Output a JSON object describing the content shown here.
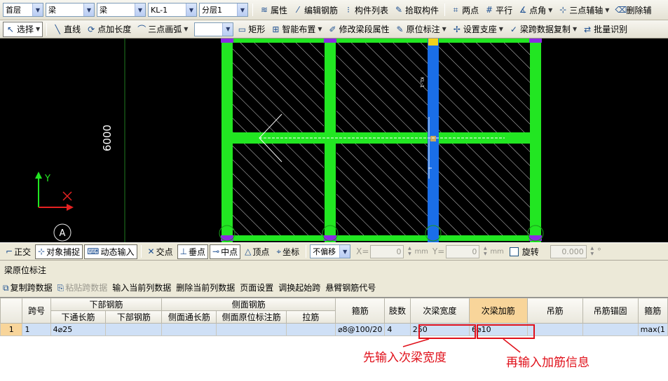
{
  "toolbar1": {
    "combos": [
      {
        "value": "首层",
        "w": 58
      },
      {
        "value": "梁",
        "w": 70
      },
      {
        "value": "梁",
        "w": 70
      },
      {
        "value": "KL-1",
        "w": 70
      },
      {
        "value": "分层1",
        "w": 70
      }
    ],
    "buttons": [
      {
        "icon": "≋",
        "label": "属性",
        "name": "properties-button"
      },
      {
        "icon": "⁄",
        "label": "编辑钢筋",
        "name": "edit-rebar-button"
      },
      {
        "icon": "⁝",
        "label": "构件列表",
        "name": "component-list-button"
      },
      {
        "icon": "✎",
        "label": "拾取构件",
        "name": "pick-component-button"
      },
      {
        "icon": "⌗",
        "label": "两点",
        "name": "two-point-button"
      },
      {
        "icon": "#",
        "label": "平行",
        "name": "parallel-button"
      },
      {
        "icon": "∡",
        "label": "点角",
        "name": "point-angle-button",
        "dd": true
      },
      {
        "icon": "⊹",
        "label": "三点辅轴",
        "name": "three-point-axis-button",
        "dd": true
      },
      {
        "icon": "⌫",
        "label": "删除辅",
        "name": "delete-axis-button"
      }
    ]
  },
  "toolbar2": {
    "select": "选择",
    "buttons": [
      {
        "icon": "╲",
        "label": "直线",
        "name": "line-button"
      },
      {
        "icon": "⟳",
        "label": "点加长度",
        "name": "point-length-button"
      },
      {
        "icon": "⌒",
        "label": "三点画弧",
        "name": "arc-button",
        "dd": true
      }
    ],
    "buttons2": [
      {
        "icon": "▭",
        "label": "矩形",
        "name": "rectangle-button"
      },
      {
        "icon": "⊞",
        "label": "智能布置",
        "name": "smart-layout-button",
        "dd": true
      },
      {
        "icon": "✐",
        "label": "修改梁段属性",
        "name": "modify-beam-props-button"
      },
      {
        "icon": "✎",
        "label": "原位标注",
        "name": "in-situ-annotation-button",
        "dd": true
      },
      {
        "icon": "✢",
        "label": "设置支座",
        "name": "set-support-button",
        "dd": true
      },
      {
        "icon": "✓",
        "label": "梁跨数据复制",
        "name": "copy-span-data-button",
        "dd": true
      },
      {
        "icon": "⇄",
        "label": "批量识别",
        "name": "batch-recognize-button"
      }
    ]
  },
  "canvas": {
    "dimension": "6000",
    "axis_label": "A",
    "y_label": "Y"
  },
  "snapbar": {
    "buttons": [
      {
        "icon": "⌐",
        "label": "正交",
        "on": false,
        "name": "orthogonal-button"
      },
      {
        "icon": "⊹",
        "label": "对象捕捉",
        "on": true,
        "name": "object-snap-button"
      },
      {
        "icon": "⌨",
        "label": "动态输入",
        "on": true,
        "name": "dynamic-input-button"
      },
      {
        "icon": "✕",
        "label": "交点",
        "on": false,
        "name": "intersection-button"
      },
      {
        "icon": "⊥",
        "label": "垂点",
        "on": true,
        "name": "perpendicular-button"
      },
      {
        "icon": "⊸",
        "label": "中点",
        "on": true,
        "name": "midpoint-button"
      },
      {
        "icon": "△",
        "label": "顶点",
        "on": false,
        "name": "vertex-button"
      },
      {
        "icon": "⌖",
        "label": "坐标",
        "on": false,
        "name": "coordinate-button"
      }
    ],
    "offset_select": "不偏移",
    "x_label": "X=",
    "x_value": "0",
    "y_label": "Y=",
    "y_value": "0",
    "unit": "mm",
    "rotate_label": "旋转",
    "rotate_value": "0.000",
    "degree": "°"
  },
  "panel": {
    "title": "梁原位标注",
    "tools": [
      {
        "icon": "⧉",
        "label": "复制跨数据",
        "disabled": false
      },
      {
        "icon": "⎘",
        "label": "粘贴跨数据",
        "disabled": true
      },
      {
        "icon": "",
        "label": "输入当前列数据",
        "disabled": false
      },
      {
        "icon": "",
        "label": "删除当前列数据",
        "disabled": false
      },
      {
        "icon": "",
        "label": "页面设置",
        "disabled": false
      },
      {
        "icon": "",
        "label": "调换起始跨",
        "disabled": false
      },
      {
        "icon": "",
        "label": "悬臂钢筋代号",
        "disabled": false
      }
    ]
  },
  "grid": {
    "col_span": "跨号",
    "group_bottom": "下部钢筋",
    "group_side": "侧面钢筋",
    "sub_headers": [
      "下通长筋",
      "下部钢筋",
      "侧面通长筋",
      "侧面原位标注筋",
      "拉筋"
    ],
    "col_stirrup": "箍筋",
    "col_legs": "肢数",
    "col_sec_width": "次梁宽度",
    "col_sec_rebar": "次梁加筋",
    "col_hanger": "吊筋",
    "col_hanger_anchor": "吊筋锚固",
    "col_last": "箍筋",
    "row": {
      "rownum": "1",
      "span": "1",
      "bottom_through": "4⌀25",
      "bottom": "",
      "side_through": "",
      "side_insitu": "",
      "tie": "",
      "stirrup": "⌀8@100/20",
      "legs": "4",
      "sec_width": "250",
      "sec_rebar": "6⌀10",
      "hanger": "",
      "hanger_anchor": "",
      "last": "max(1"
    }
  },
  "annotations": {
    "first": "先输入次梁宽度",
    "second": "再输入加筋信息"
  }
}
